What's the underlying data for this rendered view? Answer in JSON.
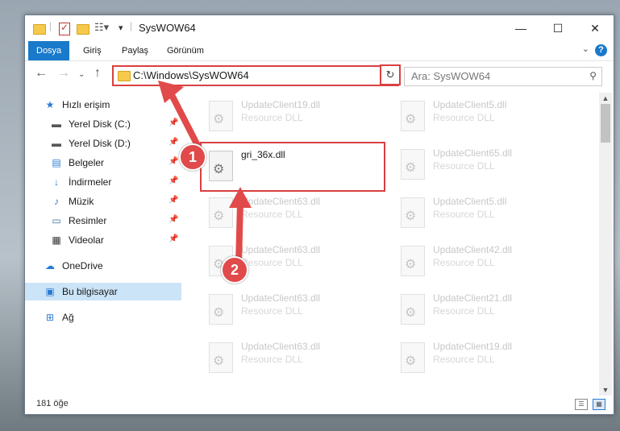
{
  "window": {
    "title": "SysWOW64",
    "controls": {
      "minimize": "—",
      "maximize": "☐",
      "close": "✕"
    }
  },
  "ribbon": {
    "tabs": [
      {
        "label": "Dosya",
        "active": true
      },
      {
        "label": "Giriş",
        "active": false
      },
      {
        "label": "Paylaş",
        "active": false
      },
      {
        "label": "Görünüm",
        "active": false
      }
    ],
    "help": "?"
  },
  "navigation": {
    "address": "C:\\Windows\\SysWOW64",
    "search_placeholder": "Ara: SysWOW64"
  },
  "sidebar": {
    "items": [
      {
        "label": "Hızlı erişim",
        "icon": "star-icon",
        "level": "top",
        "pinned": false
      },
      {
        "label": "Yerel Disk (C:)",
        "icon": "drive-icon",
        "level": "child",
        "pinned": true
      },
      {
        "label": "Yerel Disk (D:)",
        "icon": "drive-icon",
        "level": "child",
        "pinned": true
      },
      {
        "label": "Belgeler",
        "icon": "documents-icon",
        "level": "child",
        "pinned": true
      },
      {
        "label": "İndirmeler",
        "icon": "download-icon",
        "level": "child",
        "pinned": true
      },
      {
        "label": "Müzik",
        "icon": "music-icon",
        "level": "child",
        "pinned": true
      },
      {
        "label": "Resimler",
        "icon": "pictures-icon",
        "level": "child",
        "pinned": true
      },
      {
        "label": "Videolar",
        "icon": "video-icon",
        "level": "child",
        "pinned": true
      },
      {
        "label": "OneDrive",
        "icon": "cloud-icon",
        "level": "top",
        "pinned": false
      },
      {
        "label": "Bu bilgisayar",
        "icon": "computer-icon",
        "level": "top",
        "pinned": false,
        "selected": true
      },
      {
        "label": "Ağ",
        "icon": "network-icon",
        "level": "top",
        "pinned": false
      }
    ]
  },
  "files": {
    "left_column": [
      {
        "name": "UpdateClient19.dll",
        "type": "Resource DLL"
      },
      {
        "name": "gri_36x.dll",
        "type": "",
        "highlight": true
      },
      {
        "name": "UpdateClient63.dll",
        "type": "Resource DLL"
      },
      {
        "name": "UpdateClient63.dll",
        "type": "Resource DLL"
      },
      {
        "name": "UpdateClient63.dll",
        "type": "Resource DLL"
      },
      {
        "name": "UpdateClient63.dll",
        "type": "Resource DLL"
      }
    ],
    "right_column": [
      {
        "name": "UpdateClient5.dll",
        "type": "Resource DLL"
      },
      {
        "name": "UpdateClient65.dll",
        "type": "Resource DLL"
      },
      {
        "name": "UpdateClient5.dll",
        "type": "Resource DLL"
      },
      {
        "name": "UpdateClient42.dll",
        "type": "Resource DLL"
      },
      {
        "name": "UpdateClient21.dll",
        "type": "Resource DLL"
      },
      {
        "name": "UpdateClient19.dll",
        "type": "Resource DLL"
      }
    ]
  },
  "status": {
    "item_count": "181 öğe"
  },
  "annotations": {
    "step1": "1",
    "step2": "2",
    "color": "#e14a4a"
  }
}
